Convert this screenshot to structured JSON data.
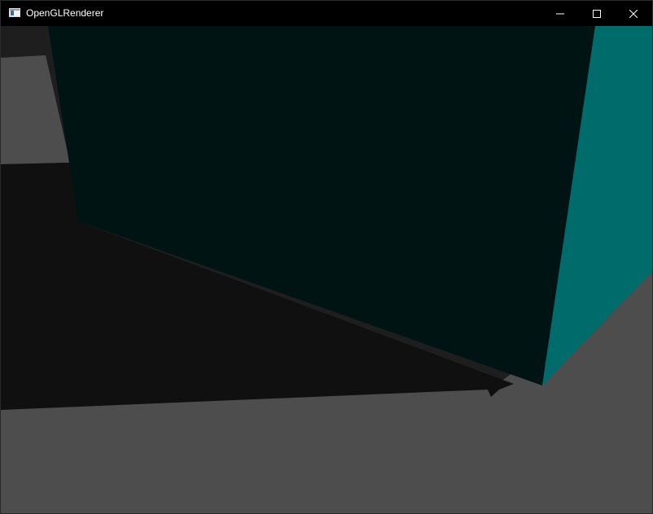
{
  "window": {
    "title": "OpenGLRenderer",
    "icon": "app-window-icon",
    "controls": {
      "minimize_icon": "minimize-icon",
      "maximize_icon": "maximize-icon",
      "close_icon": "close-icon"
    }
  },
  "scene": {
    "clear_color": "#1e1e1e",
    "colors": {
      "floor": "#4d4d4d",
      "shadow": "#101010",
      "cube_front": "#001414",
      "cube_side": "#006b6b"
    }
  }
}
